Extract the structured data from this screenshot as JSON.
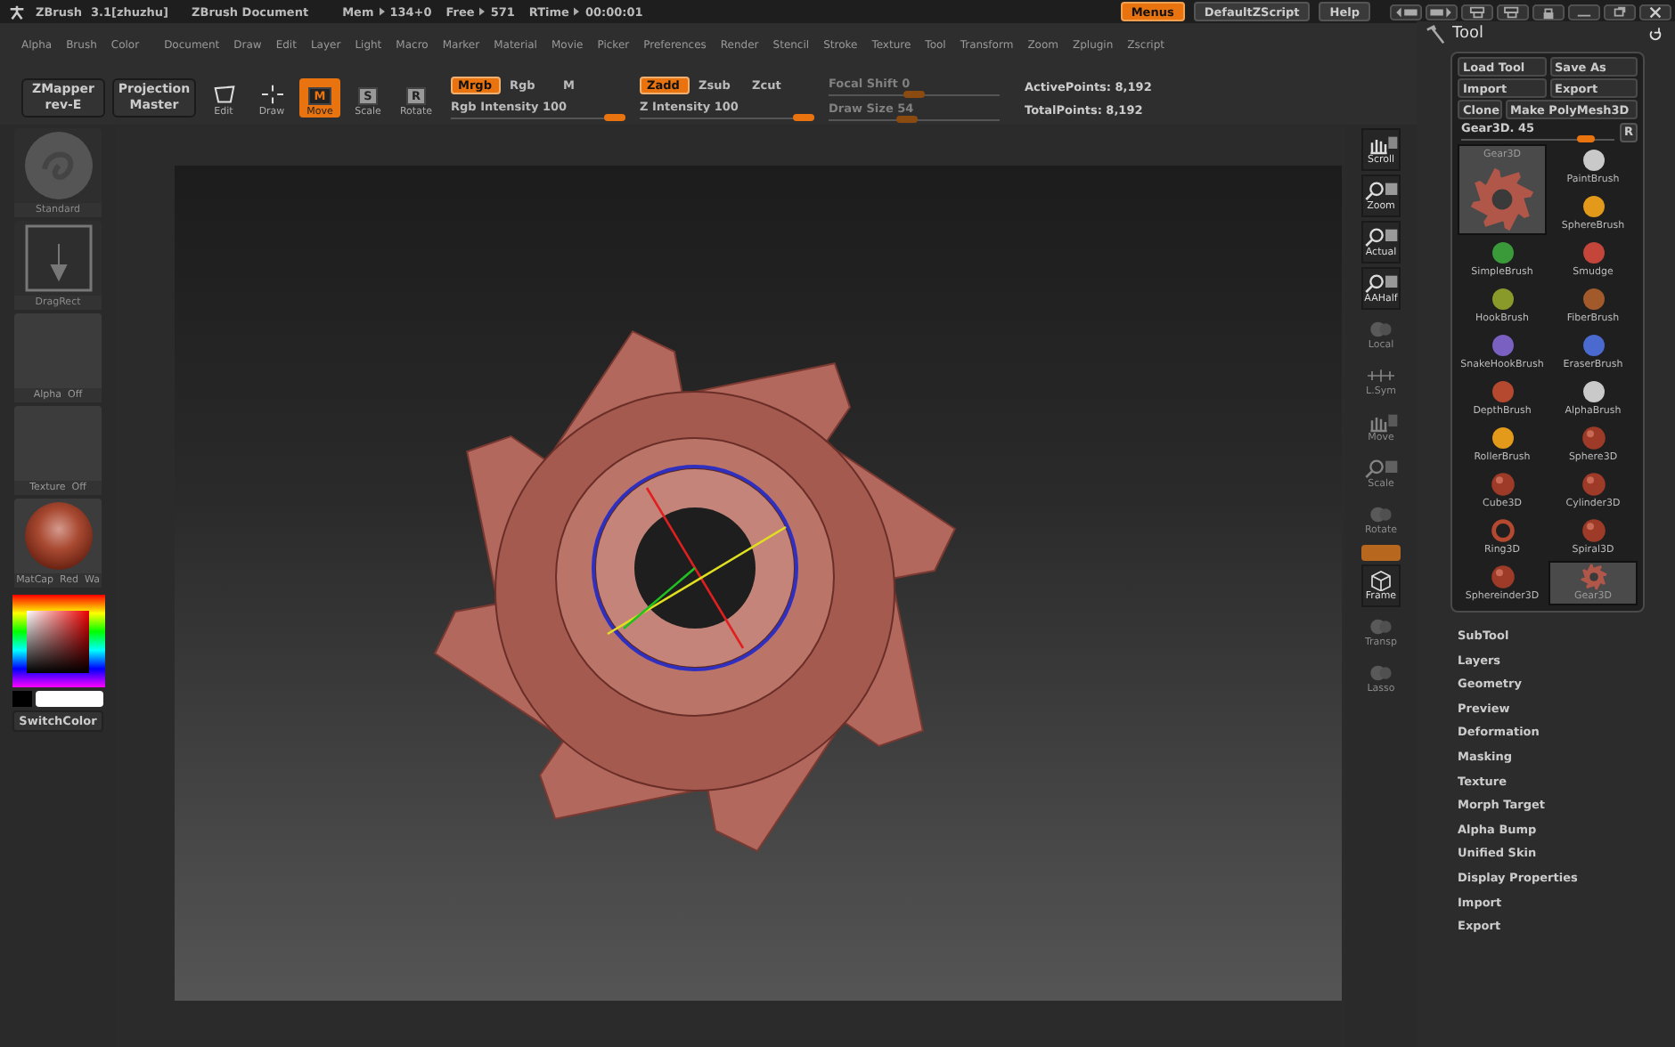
{
  "title_bar": {
    "app": "ZBrush",
    "version": "3.1[zhuzhu]",
    "document": "ZBrush Document",
    "readouts": [
      {
        "label": "Mem",
        "value": "134+0"
      },
      {
        "label": "Free",
        "value": "571"
      },
      {
        "label": "RTime",
        "value": "00:00:01"
      }
    ],
    "buttons": [
      {
        "label": "Menus",
        "selected": true
      },
      {
        "label": "DefaultZScript",
        "selected": false
      },
      {
        "label": "Help",
        "selected": false
      }
    ]
  },
  "menu_bar": [
    "Alpha",
    "Brush",
    "Color",
    "Document",
    "Draw",
    "Edit",
    "Layer",
    "Light",
    "Macro",
    "Marker",
    "Material",
    "Movie",
    "Picker",
    "Preferences",
    "Render",
    "Stencil",
    "Stroke",
    "Texture",
    "Tool",
    "Transform",
    "Zoom",
    "Zplugin",
    "Zscript"
  ],
  "toolbar": {
    "plugin_buttons": [
      {
        "line1": "ZMapper",
        "line2": "rev-E"
      },
      {
        "line1": "Projection",
        "line2": "Master"
      }
    ],
    "modes": [
      {
        "kind": "edit",
        "label": "Edit",
        "selected": false
      },
      {
        "kind": "draw",
        "label": "Draw",
        "selected": false
      },
      {
        "kind": "letter",
        "key": "M",
        "label": "Move",
        "selected": true
      },
      {
        "kind": "letter",
        "key": "S",
        "label": "Scale",
        "selected": false
      },
      {
        "kind": "letter",
        "key": "R",
        "label": "Rotate",
        "selected": false
      }
    ],
    "color_modes": [
      {
        "label": "Mrgb",
        "selected": true
      },
      {
        "label": "Rgb",
        "selected": false
      },
      {
        "label": "M",
        "selected": false
      }
    ],
    "rgb_intensity": {
      "label": "Rgb Intensity",
      "value": "100",
      "level": 1,
      "disabled": false
    },
    "z_modes": [
      {
        "label": "Zadd",
        "selected": true
      },
      {
        "label": "Zsub",
        "selected": false
      },
      {
        "label": "Zcut",
        "selected": false
      }
    ],
    "z_intensity": {
      "label": "Z Intensity",
      "value": "100",
      "level": 1,
      "disabled": false
    },
    "focal_shift": {
      "label": "Focal Shift",
      "value": "0",
      "level": 0.5,
      "disabled": true
    },
    "draw_size": {
      "label": "Draw Size",
      "value": "54",
      "level": 0.45,
      "disabled": true
    },
    "stats": [
      {
        "label": "ActivePoints:",
        "value": "8,192"
      },
      {
        "label": "TotalPoints:",
        "value": "8,192"
      }
    ]
  },
  "left_shelf": {
    "tiles": [
      {
        "kind": "brush",
        "label": "Standard",
        "disabled": true
      },
      {
        "kind": "stroke",
        "label": "DragRect",
        "disabled": true
      },
      {
        "kind": "empty",
        "label": "Alpha  Off",
        "disabled": false
      },
      {
        "kind": "empty",
        "label": "Texture  Off",
        "disabled": false
      },
      {
        "kind": "material",
        "label": "MatCap  Red  Wa",
        "disabled": false
      }
    ],
    "switch_color": "SwitchColor"
  },
  "right_shelf": [
    {
      "kind": "scroll",
      "label": "Scroll",
      "disabled": false
    },
    {
      "kind": "zoom",
      "label": "Zoom",
      "disabled": false
    },
    {
      "kind": "zoom",
      "label": "Actual",
      "disabled": false
    },
    {
      "kind": "zoom",
      "label": "AAHalf",
      "disabled": false
    },
    {
      "kind": "local",
      "label": "Local",
      "disabled": true
    },
    {
      "kind": "sym",
      "label": "L.Sym",
      "disabled": true
    },
    {
      "kind": "scroll",
      "label": "Move",
      "disabled": true
    },
    {
      "kind": "zoom",
      "label": "Scale",
      "disabled": true
    },
    {
      "kind": "local",
      "label": "Rotate",
      "disabled": true
    },
    {
      "kind": "toggle",
      "disabled": false
    },
    {
      "kind": "frame",
      "label": "Frame",
      "disabled": false
    },
    {
      "kind": "local",
      "label": "Transp",
      "disabled": true
    },
    {
      "kind": "local",
      "label": "Lasso",
      "disabled": true
    }
  ],
  "tool_palette": {
    "title": "Tool",
    "button_rows": [
      [
        "Load Tool",
        "Save As"
      ],
      [
        "Import",
        "Export"
      ],
      [
        "Clone",
        "Make PolyMesh3D"
      ]
    ],
    "slider": {
      "label": "Gear3D. 45",
      "level": 0.85
    },
    "reset_button": "R",
    "tools": [
      {
        "kind": "gear",
        "label": "Gear3D",
        "selected": true
      },
      {
        "kind": "brush",
        "label": "PaintBrush",
        "selected": false
      },
      {
        "kind": "brush",
        "label": "SphereBrush",
        "selected": false
      },
      {
        "kind": "brush",
        "label": "SimpleBrush",
        "selected": false
      },
      {
        "kind": "brush",
        "label": "Smudge",
        "selected": false
      },
      {
        "kind": "brush",
        "label": "HookBrush",
        "selected": false
      },
      {
        "kind": "brush",
        "label": "FiberBrush",
        "selected": false
      },
      {
        "kind": "brush",
        "label": "SnakeHookBrush",
        "selected": false
      },
      {
        "kind": "brush",
        "label": "EraserBrush",
        "selected": false
      },
      {
        "kind": "brush",
        "label": "DepthBrush",
        "selected": false
      },
      {
        "kind": "brush",
        "label": "AlphaBrush",
        "selected": false
      },
      {
        "kind": "brush",
        "label": "RollerBrush",
        "selected": false
      },
      {
        "kind": "primitive",
        "label": "Sphere3D",
        "selected": false
      },
      {
        "kind": "primitive",
        "label": "Cube3D",
        "selected": false
      },
      {
        "kind": "primitive",
        "label": "Cylinder3D",
        "selected": false
      },
      {
        "kind": "ring",
        "label": "Ring3D",
        "selected": false
      },
      {
        "kind": "primitive",
        "label": "Spiral3D",
        "selected": false
      },
      {
        "kind": "primitive",
        "label": "Sphereinder3D",
        "selected": false
      },
      {
        "kind": "gear",
        "label": "Gear3D",
        "selected": true
      }
    ],
    "sections": [
      "SubTool",
      "Layers",
      "Geometry",
      "Preview",
      "Deformation",
      "Masking",
      "Texture",
      "Morph Target",
      "Alpha Bump",
      "Unified Skin",
      "Display Properties",
      "Import",
      "Export"
    ]
  }
}
